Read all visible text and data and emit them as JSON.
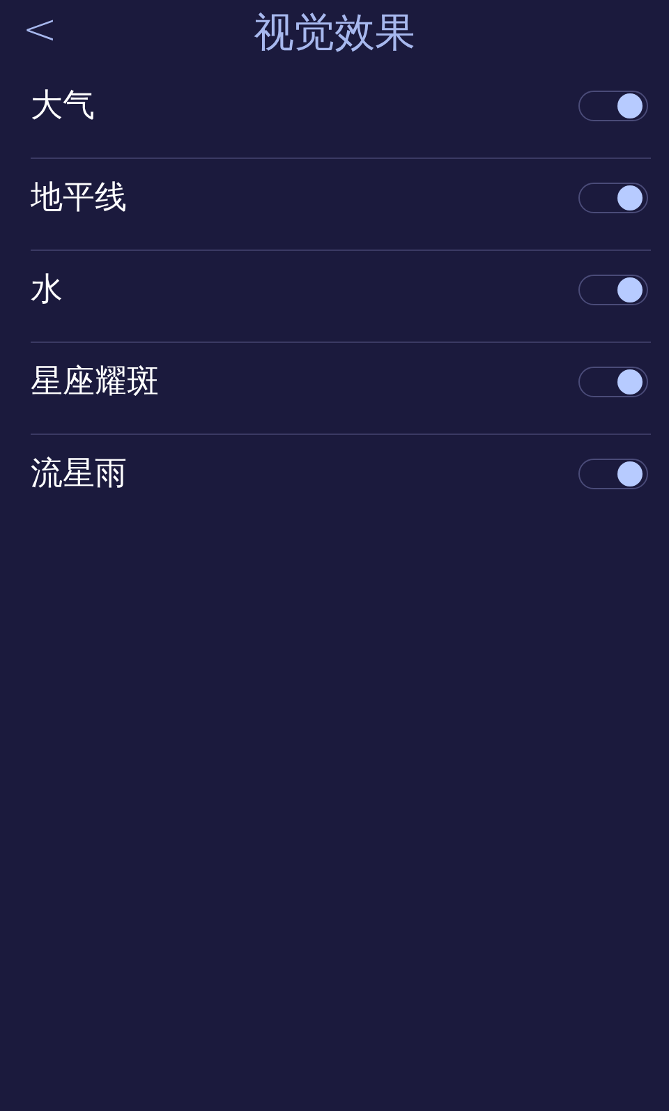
{
  "header": {
    "back": "<",
    "title": "视觉效果"
  },
  "settings": [
    {
      "label": "大气",
      "on": true
    },
    {
      "label": "地平线",
      "on": true
    },
    {
      "label": "水",
      "on": true
    },
    {
      "label": "星座耀斑",
      "on": true
    },
    {
      "label": "流星雨",
      "on": true
    }
  ]
}
